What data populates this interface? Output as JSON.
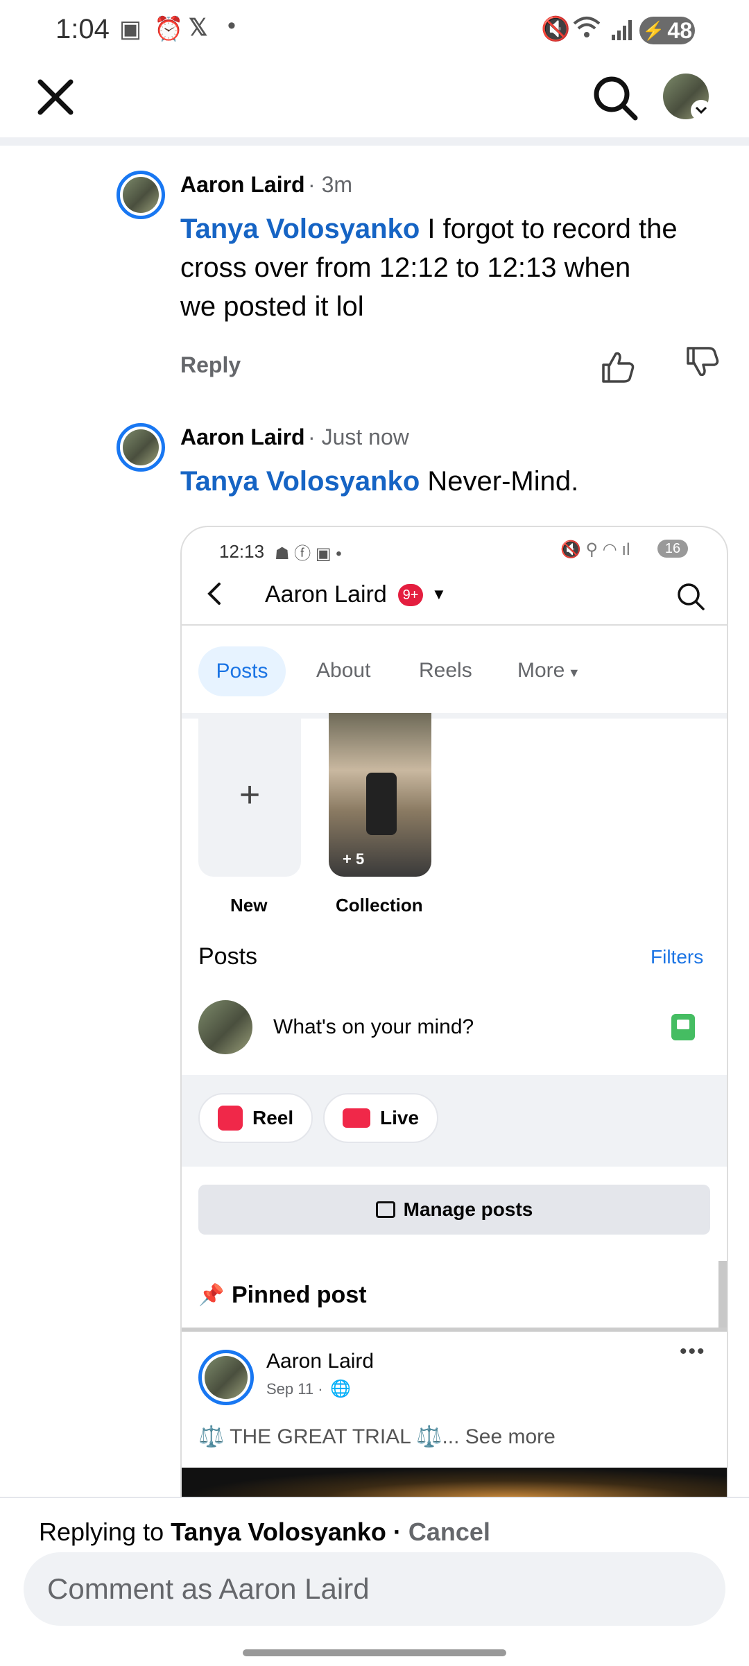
{
  "status_bar": {
    "time": "1:04",
    "battery": "48"
  },
  "comments": [
    {
      "author": "Aaron Laird",
      "time": "· 3m",
      "mention": "Tanya Volosyanko",
      "text_line1": " I forgot to record the",
      "text_line2": "cross over from 12:12 to 12:13 when",
      "text_line3": "we posted it lol",
      "reply_label": "Reply"
    },
    {
      "author": "Aaron Laird",
      "time": "· Just now",
      "mention": "Tanya Volosyanko",
      "text": " Never-Mind."
    }
  ],
  "embedded": {
    "status_time": "12:13",
    "battery": "16",
    "profile_name": "Aaron Laird",
    "notif_badge": "9+",
    "tabs": [
      "Posts",
      "About",
      "Reels",
      "More"
    ],
    "new_label": "New",
    "collection_label": "Collection",
    "collection_count": "+ 5",
    "posts_heading": "Posts",
    "filters_label": "Filters",
    "composer_placeholder": "What's on your mind?",
    "reel_label": "Reel",
    "live_label": "Live",
    "manage_posts_label": "Manage posts",
    "pinned_label": "Pinned post",
    "post_author": "Aaron Laird",
    "post_date": "Sep 11 ·",
    "post_text": "⚖️ THE GREAT TRIAL ⚖️...",
    "see_more": "See more"
  },
  "reply_bar": {
    "prefix": "Replying to ",
    "target": "Tanya Volosyanko",
    "separator": " · ",
    "cancel": "Cancel",
    "input_placeholder": "Comment as Aaron Laird"
  }
}
